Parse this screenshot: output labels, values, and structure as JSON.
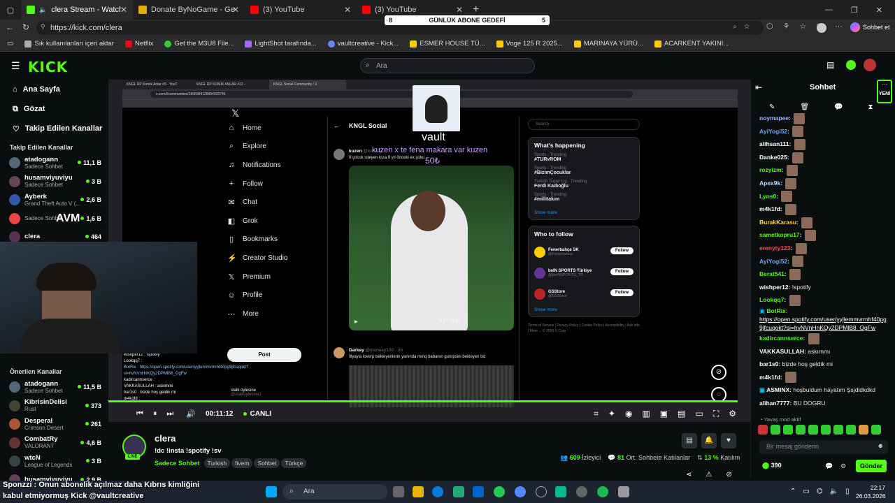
{
  "browser": {
    "tabs": [
      {
        "label": "clera Stream - Watch Live on K",
        "color": "#53fc18"
      },
      {
        "label": "Donate ByNoGame - Gelen/Giden",
        "color": "#e0b000"
      },
      {
        "label": "(3) YouTube",
        "color": "#ff0000"
      },
      {
        "label": "(3) YouTube",
        "color": "#ff0000"
      }
    ],
    "new_tab": "+",
    "url": "https://kick.com/clera",
    "profile": "Sohbet et",
    "bookmarks": [
      "Sık kullanılanları içeri aktar",
      "Netflix",
      "Get the M3U8 File...",
      "LightShot tarafında...",
      "vaultcreative - Kick...",
      "ESMER HOUSE TÜ...",
      "Voge 125 R 2025...",
      "MARINAYA YÜRÜ...",
      "ACARKENT YAKINI..."
    ]
  },
  "goal": {
    "left": "8",
    "label": "GÜNLÜK ABONE GEDEFİ",
    "right": "5"
  },
  "kick": {
    "logo": "KICK",
    "search_placeholder": "Ara",
    "nav": [
      "Ana Sayfa",
      "Gözat",
      "Takip Edilen Kanallar"
    ],
    "followed_title": "Takip Edilen Kanallar",
    "followed": [
      {
        "name": "atadogann",
        "cat": "Sadece Sohbet",
        "viewers": "11,1 B"
      },
      {
        "name": "husamviyuviyu",
        "cat": "Sadece Sohbet",
        "viewers": "3 B"
      },
      {
        "name": "Ayberk",
        "cat": "Grand Theft Auto V (...",
        "viewers": "2,6 B"
      },
      {
        "name": "",
        "cat": "Sadece Sohbet",
        "viewers": "1,6 B"
      },
      {
        "name": "clera",
        "cat": "",
        "viewers": "464"
      }
    ],
    "sponsor_overlay": "AVM",
    "recommended_title": "Önerilen Kanallar",
    "recommended": [
      {
        "name": "atadogann",
        "cat": "Sadece Sohbet",
        "viewers": "11,5 B"
      },
      {
        "name": "KibrisinDelisi",
        "cat": "Rust",
        "viewers": "373"
      },
      {
        "name": "Desperal",
        "cat": "Crimson Desert",
        "viewers": "261"
      },
      {
        "name": "CombatRy",
        "cat": "VALORANT",
        "viewers": "4,6 B"
      },
      {
        "name": "wtcN",
        "cat": "League of Legends",
        "viewers": "3 B"
      },
      {
        "name": "husamviyuviyu",
        "cat": "",
        "viewers": "2,9 B"
      }
    ]
  },
  "stream_screen": {
    "tabs": [
      "KNGL RP Komik Anlar #3 - YouT",
      "KNGL RP KOMİK ANLAR #12 - ",
      "KNGL Social Community / X"
    ],
    "url": "x.com/i/communities/1895084128954933746",
    "x_nav": [
      "Home",
      "Explore",
      "Notifications",
      "Follow",
      "Chat",
      "Grok",
      "Bookmarks",
      "Creator Studio",
      "Premium",
      "Profile",
      "More"
    ],
    "post_btn": "Post",
    "community": "KNGL Social",
    "post1_user": "kuzen",
    "post1_handle": "@kuzenyi",
    "post1_text": "9 çocuk isteyen kıza 9 yıl önceki ex şoku",
    "video_time": "0:07 / 0:32",
    "donation_name": "vault",
    "donation_msg": "kuzen x te fena makara var kuzen",
    "donation_amount": "50₺",
    "post2_user": "Darkey",
    "post2_handle": "@moneey100 · 3h",
    "post2_text": "İllyayla loverp bekleyenlerin yanında mınq babanın gunrpsini bekleyen biz",
    "x_search": "Search",
    "happening_title": "What's happening",
    "trends": [
      {
        "meta": "Sports · Trending",
        "name": "#TURvROM"
      },
      {
        "meta": "Sports · Trending",
        "name": "#BizimÇocuklar"
      },
      {
        "meta": "Turkish Super Lig · Trending",
        "name": "Ferdi Kadıoğlu"
      },
      {
        "meta": "Sports · Trending",
        "name": "#millitakım"
      }
    ],
    "show_more": "Show more",
    "follow_title": "Who to follow",
    "follow": [
      {
        "name": "Fenerbahçe SK",
        "handle": "@Fenerbahce"
      },
      {
        "name": "beIN SPORTS Türkiye",
        "handle": "@beINSPORTS_TR"
      },
      {
        "name": "GSStore",
        "handle": "@GSStore"
      }
    ],
    "follow_btn": "Follow",
    "footer": "Terms of Service | Privacy Policy | Cookie Policy | Accessibility | Ads info | More ... © 2026 X Corp.",
    "chat_mirror": [
      "wishper12 : !spotify",
      "Lookqq7 :",
      "BotRix : https://open.spotify.com/user/yyjlemmvrmhf40pg9jfcuqokt?si=hvNVnHnKQy2DPMlB8_OgFw",
      "kadircannserce :",
      "VAKKASULLAH : askımmı",
      "bar1s0 : bizde hoş geldik mi",
      "m4k1fd :"
    ],
    "mirror_user": "stalk öylesine",
    "mirror_handle": "@stalkoylesine1"
  },
  "player": {
    "time": "00:11:12",
    "live": "CANLI",
    "progress": 0.98
  },
  "stream_info": {
    "channel": "clera",
    "live_badge": "LIVE",
    "title": "!dc !insta !spotify !sv",
    "category": "Sadece Sohbet",
    "tags": [
      "Turkish",
      "fivem",
      "Sohbet",
      "Türkçe"
    ],
    "viewers": "609",
    "viewers_label": "İzleyici",
    "chatters": "81",
    "chatters_label": "Ort. Sohbete Katılanlar",
    "participation": "13 %",
    "participation_label": "Katılım"
  },
  "chat": {
    "title": "Sohbet",
    "new_label": "YENİ",
    "messages": [
      {
        "user": "noymapee",
        "text": "",
        "color": "#9ab4ff",
        "emote": true
      },
      {
        "user": "AyiYogi52",
        "text": "",
        "color": "#6aa8ff",
        "emote": true
      },
      {
        "user": "alihsan111",
        "text": "",
        "color": "#ffffff",
        "emote": true
      },
      {
        "user": "Danke025",
        "text": "",
        "color": "#ffffff",
        "emote": true
      },
      {
        "user": "rozyizm",
        "text": "",
        "color": "#53fc18",
        "emote": true
      },
      {
        "user": "Apex9k",
        "text": "",
        "color": "#b0e0ff",
        "emote": true
      },
      {
        "user": "Lyns0",
        "text": "",
        "color": "#53fc18",
        "emote": true
      },
      {
        "user": "m4k1fd",
        "text": "",
        "color": "#ffffff",
        "emote": true
      },
      {
        "user": "BurakKarasu",
        "text": "",
        "color": "#ffd24a",
        "emote": true
      },
      {
        "user": "sametkopru17",
        "text": "",
        "color": "#53fc18",
        "emote": true
      },
      {
        "user": "erenyty123",
        "text": "",
        "color": "#ff4a4a",
        "emote": true
      },
      {
        "user": "AyiYogi52",
        "text": "",
        "color": "#6aa8ff",
        "emote": true
      },
      {
        "user": "Berat541",
        "text": "",
        "color": "#53fc18",
        "emote": true
      },
      {
        "user": "wishper12",
        "text": "!spotify",
        "color": "#ffffff",
        "emote": false
      },
      {
        "user": "Lookqq7",
        "text": "",
        "color": "#53fc18",
        "emote": true
      }
    ],
    "botrix_user": "BotRix",
    "botrix_link": "https://open.spotify.com/user/yyjlemmvrmhf40pg9jfcuqokt?si=hvNVnHnKQy2DPMlB8_OgFw",
    "messages2": [
      {
        "user": "kadircannserce",
        "text": "",
        "color": "#53fc18",
        "emote": true
      },
      {
        "user": "VAKKASULLAH",
        "text": "askımmı",
        "color": "#ffffff",
        "emote": false
      },
      {
        "user": "bar1s0",
        "text": "bizde hoş geldik mi",
        "color": "#ffffff",
        "emote": false
      },
      {
        "user": "m4k1fd",
        "text": "",
        "color": "#ffffff",
        "emote": true
      },
      {
        "user": "ASMINX",
        "text": "hoşbuldum hayatım Şsjdldkdkd",
        "color": "#ffffff",
        "emote": false
      },
      {
        "user": "alihan7777",
        "text": "BU DOGRU",
        "color": "#ffffff",
        "emote": false
      }
    ],
    "slow_mode": "Yavaş mod aktif",
    "input_placeholder": "Bir mesaj gönderin",
    "points": "390",
    "send": "Gönder"
  },
  "caption": {
    "line1": "Sponzzi : Onun abonelik açılmaz daha Kıbrıs kimliğini",
    "line2": "kabul etmiyormuş Kick @vaultcreative"
  },
  "taskbar": {
    "search": "Ara",
    "time": "22:17",
    "date": "26.03.2026"
  }
}
